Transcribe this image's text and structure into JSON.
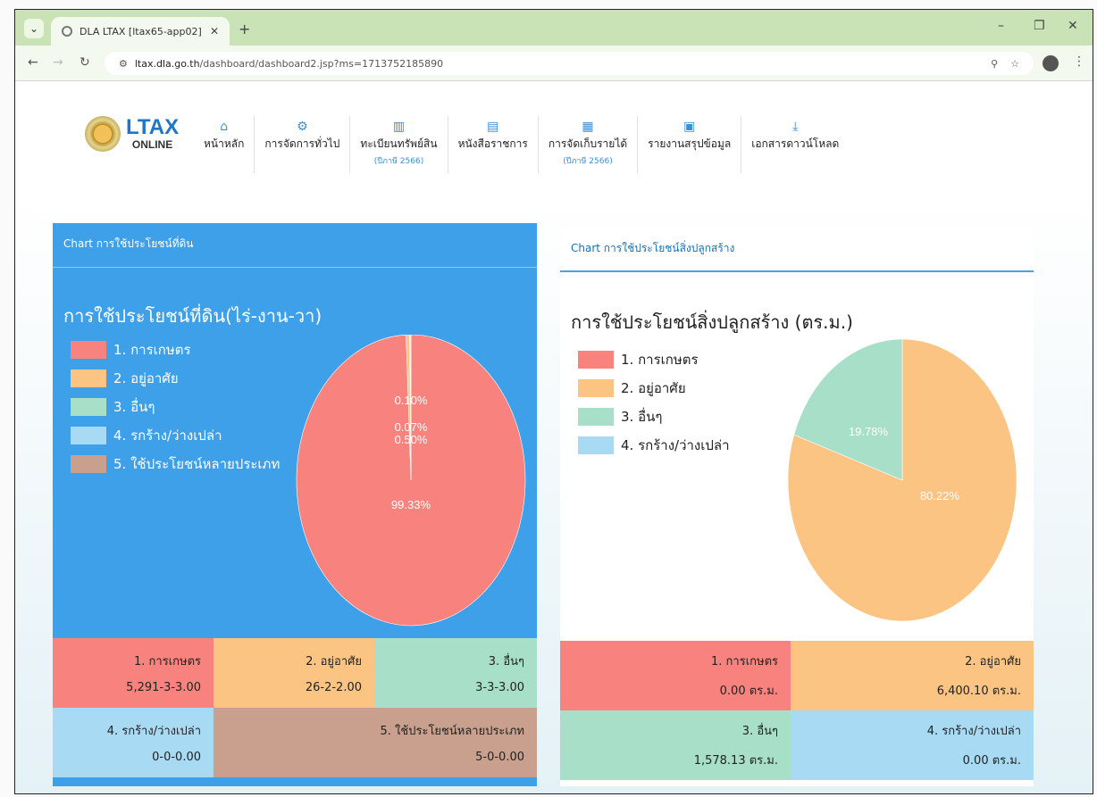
{
  "browser": {
    "tab_title": "DLA LTAX [ltax65-app02]",
    "url_host": "ltax.dla.go.th",
    "url_path": "/dashboard/dashboard2.jsp?ms=1713752185890"
  },
  "header": {
    "logo_main": "LTAX",
    "logo_sub": "ONLINE",
    "menu": [
      {
        "label": "หน้าหลัก",
        "sub": "",
        "icon": "home-icon"
      },
      {
        "label": "การจัดการทั่วไป",
        "sub": "",
        "icon": "gears-icon"
      },
      {
        "label": "ทะเบียนทรัพย์สิน",
        "sub": "(ปีภาษี 2566)",
        "icon": "book-icon"
      },
      {
        "label": "หนังสือราชการ",
        "sub": "",
        "icon": "document-icon"
      },
      {
        "label": "การจัดเก็บรายได้",
        "sub": "(ปีภาษี 2566)",
        "icon": "calculator-icon"
      },
      {
        "label": "รายงานสรุปข้อมูล",
        "sub": "",
        "icon": "report-icon"
      },
      {
        "label": "เอกสารดาวน์โหลด",
        "sub": "",
        "icon": "download-icon"
      }
    ]
  },
  "colors": {
    "agri": "#f8837e",
    "residential": "#fbc483",
    "other": "#a8dfc9",
    "vacant": "#a9daf3",
    "multi": "#c9a08d",
    "card_blue": "#3ea0e8"
  },
  "land": {
    "card_title": "Chart การใช้ประโยชน์ที่ดิน",
    "chart_title": "การใช้ประโยชน์ที่ดิน(ไร่-งาน-วา)",
    "legend": [
      "1. การเกษตร",
      "2. อยู่อาศัย",
      "3. อื่นๆ",
      "4. รกร้าง/ว่างเปล่า",
      "5. ใช้ประโยชน์หลายประเภท"
    ],
    "table": [
      {
        "label": "1. การเกษตร",
        "value": "5,291-3-3.00"
      },
      {
        "label": "2. อยู่อาศัย",
        "value": "26-2-2.00"
      },
      {
        "label": "3. อื่นๆ",
        "value": "3-3-3.00"
      },
      {
        "label": "4. รกร้าง/ว่างเปล่า",
        "value": "0-0-0.00"
      },
      {
        "label": "5. ใช้ประโยชน์หลายประเภท",
        "value": "5-0-0.00"
      }
    ]
  },
  "building": {
    "card_title": "Chart การใช้ประโยชน์สิ่งปลูกสร้าง",
    "chart_title": "การใช้ประโยชน์สิ่งปลูกสร้าง (ตร.ม.)",
    "legend": [
      "1. การเกษตร",
      "2. อยู่อาศัย",
      "3. อื่นๆ",
      "4. รกร้าง/ว่างเปล่า"
    ],
    "table": [
      {
        "label": "1. การเกษตร",
        "value": "0.00 ตร.ม."
      },
      {
        "label": "2. อยู่อาศัย",
        "value": "6,400.10 ตร.ม."
      },
      {
        "label": "3. อื่นๆ",
        "value": "1,578.13 ตร.ม."
      },
      {
        "label": "4. รกร้าง/ว่างเปล่า",
        "value": "0.00 ตร.ม."
      }
    ]
  },
  "chart_data": [
    {
      "type": "pie",
      "title": "การใช้ประโยชน์ที่ดิน(ไร่-งาน-วา)",
      "categories": [
        "1. การเกษตร",
        "2. อยู่อาศัย",
        "3. อื่นๆ",
        "4. รกร้าง/ว่างเปล่า",
        "5. ใช้ประโยชน์หลายประเภท"
      ],
      "values": [
        99.33,
        0.5,
        0.07,
        0.0,
        0.1
      ],
      "labels": [
        "99.33%",
        "0.50%",
        "0.07%",
        "",
        "0.10%"
      ],
      "legend": "left"
    },
    {
      "type": "pie",
      "title": "การใช้ประโยชน์สิ่งปลูกสร้าง (ตร.ม.)",
      "categories": [
        "1. การเกษตร",
        "2. อยู่อาศัย",
        "3. อื่นๆ",
        "4. รกร้าง/ว่างเปล่า"
      ],
      "values": [
        0.0,
        80.22,
        19.78,
        0.0
      ],
      "labels": [
        "",
        "80.22%",
        "19.78%",
        ""
      ],
      "legend": "left"
    }
  ]
}
